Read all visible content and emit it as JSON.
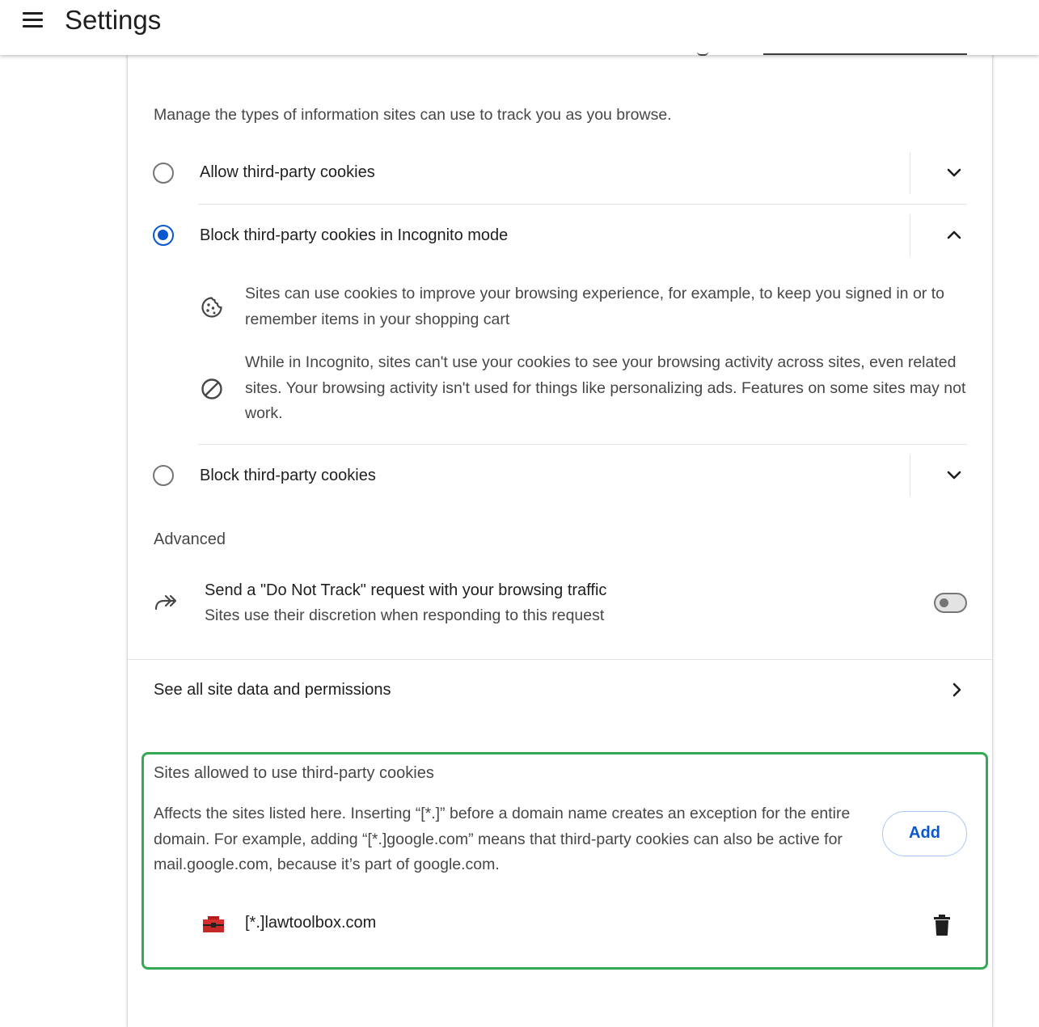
{
  "header": {
    "title": "Settings",
    "menu_icon": "hamburger-menu-icon"
  },
  "cookies": {
    "description": "Manage the types of information sites can use to track you as you browse.",
    "options": [
      {
        "label": "Allow third-party cookies",
        "selected": false,
        "expanded": false
      },
      {
        "label": "Block third-party cookies in Incognito mode",
        "selected": true,
        "expanded": true,
        "details": [
          {
            "icon": "cookie-icon",
            "text": "Sites can use cookies to improve your browsing experience, for example, to keep you signed in or to remember items in your shopping cart"
          },
          {
            "icon": "block-icon",
            "text": "While in Incognito, sites can't use your cookies to see your browsing activity across sites, even related sites. Your browsing activity isn't used for things like personalizing ads. Features on some sites may not work."
          }
        ]
      },
      {
        "label": "Block third-party cookies",
        "selected": false,
        "expanded": false
      }
    ]
  },
  "advanced": {
    "heading": "Advanced",
    "do_not_track": {
      "title": "Send a \"Do Not Track\" request with your browsing traffic",
      "subtitle": "Sites use their discretion when responding to this request",
      "enabled": false
    }
  },
  "see_all": {
    "label": "See all site data and permissions"
  },
  "allowed_sites": {
    "title": "Sites allowed to use third-party cookies",
    "description": "Affects the sites listed here. Inserting “[*.]” before a domain name creates an exception for the entire domain. For example, adding “[*.]google.com” means that third-party cookies can also be active for mail.google.com, because it’s part of google.com.",
    "add_label": "Add",
    "sites": [
      {
        "name": "[*.]lawtoolbox.com",
        "icon": "lawtoolbox-favicon"
      }
    ]
  },
  "colors": {
    "accent": "#0b57d0",
    "highlight_border": "#34a853",
    "secondary_text": "#474747"
  }
}
